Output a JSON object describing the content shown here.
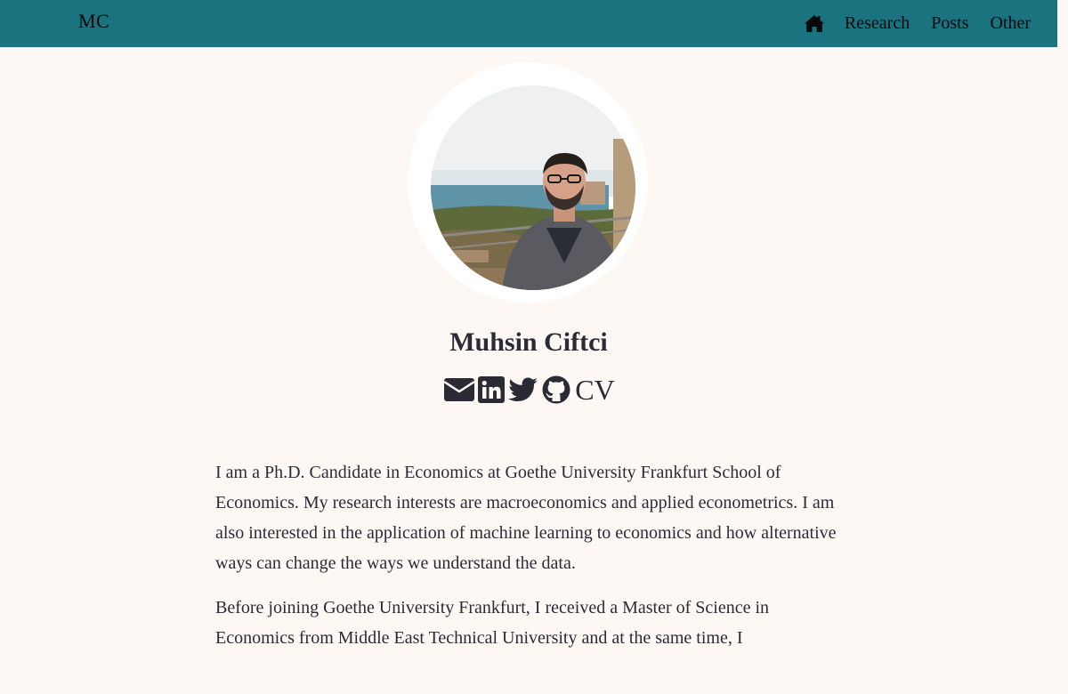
{
  "nav": {
    "brand": "MC",
    "home_icon": "home-icon",
    "links": [
      {
        "label": "Research"
      },
      {
        "label": "Posts"
      },
      {
        "label": "Other"
      }
    ]
  },
  "profile": {
    "name": "Muhsin Ciftci",
    "social": [
      {
        "icon": "envelope-icon"
      },
      {
        "icon": "linkedin-icon"
      },
      {
        "icon": "twitter-icon"
      },
      {
        "icon": "github-icon"
      }
    ],
    "cv_label": "CV"
  },
  "about": {
    "paragraphs": [
      "I am a Ph.D. Candidate in Economics at Goethe University Frankfurt School of Economics. My research interests are macroeconomics and applied econometrics. I am also interested in the application of machine learning to economics and how alternative ways can change the ways we understand the data.",
      "Before joining Goethe University Frankfurt, I received a Master of Science in Economics from Middle East Technical University and at the same time, I"
    ]
  },
  "colors": {
    "navbar": "#1b7380",
    "page_background": "#fdf8f4",
    "text": "#2b2b36"
  }
}
